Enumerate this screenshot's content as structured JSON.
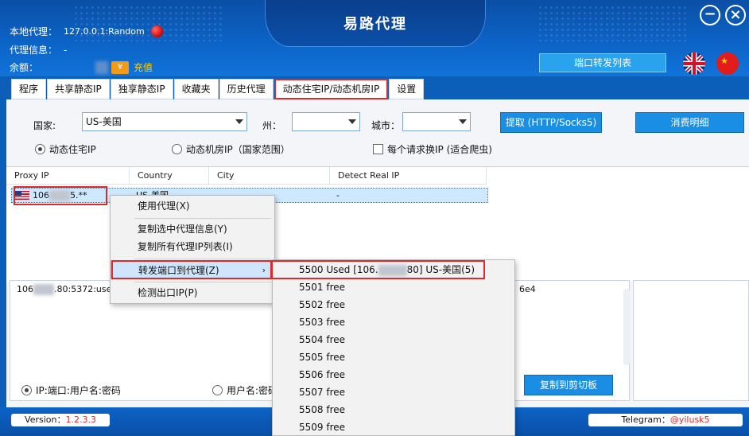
{
  "title": "易路代理",
  "info": {
    "local_proxy_label": "本地代理：",
    "local_proxy_value": "127.0.0.1:Random",
    "proxy_info_label": "代理信息：",
    "proxy_info_value": "-",
    "balance_label": "余额：",
    "coin_symbol": "¥",
    "recharge_label": "充值"
  },
  "port_forward_button": "端口转发列表",
  "tabs": [
    "程序",
    "共享静态IP",
    "独享静态IP",
    "收藏夹",
    "历史代理",
    "动态住宅IP/动态机房IP",
    "设置"
  ],
  "active_tab_index": 5,
  "filters": {
    "country_label": "国家:",
    "country_value": "US-美国",
    "state_label": "州：",
    "state_value": "",
    "city_label": "城市：",
    "city_value": "",
    "extract_button": "提取 (HTTP/Socks5)",
    "consume_button": "消费明细",
    "radio_residential": "动态住宅IP",
    "radio_datacenter": "动态机房IP（国家范围）",
    "checkbox_rotate": "每个请求换IP (适合爬虫)"
  },
  "grid": {
    "columns": [
      "Proxy IP",
      "Country",
      "City",
      "Detect Real IP"
    ],
    "row": {
      "ip_prefix": "106",
      "ip_suffix": "5.**",
      "country": "US-美国",
      "city": "",
      "detect": "-"
    }
  },
  "log_text_prefix": "106",
  "log_text_suffix": ".80:5372:user",
  "log_text_right": "6e4",
  "format": {
    "radio_ip_port_user": "IP:端口:用户名:密码",
    "radio_user_pass": "用户名:密码",
    "copy_button": "复制到剪切板"
  },
  "status": {
    "version_label": "Version：",
    "version_value": "1.2.3.3",
    "telegram_label": "Telegram：",
    "telegram_value": "@yilusk5"
  },
  "context_menu": {
    "use_proxy": "使用代理(X)",
    "copy_selected": "复制选中代理信息(Y)",
    "copy_all": "复制所有代理IP列表(I)",
    "forward_port": "转发端口到代理(Z)",
    "chevron": "›",
    "check_exit": "检测出口IP(P)"
  },
  "submenu": {
    "used_prefix": "5500 Used [106.",
    "used_suffix": "80] US-美国(5)",
    "items": [
      "5501 free",
      "5502 free",
      "5503 free",
      "5504 free",
      "5505 free",
      "5506 free",
      "5507 free",
      "5508 free",
      "5509 free"
    ]
  },
  "colors": {
    "brand_blue": "#0c63c6",
    "highlight_red": "#e02a2a",
    "recharge_yellow": "#ffd200",
    "button_blue": "#1a8ee4"
  }
}
